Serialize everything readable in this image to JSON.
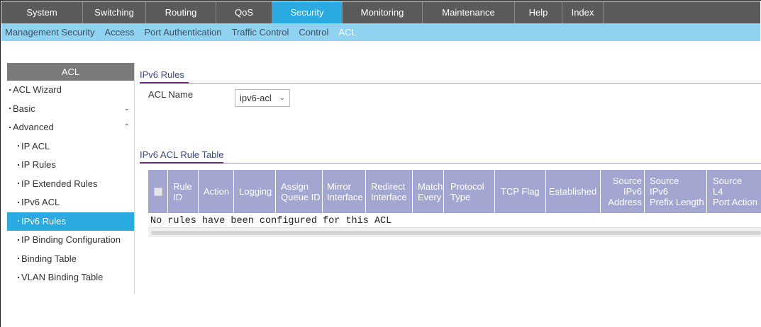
{
  "top_nav": {
    "tabs": [
      "System",
      "Switching",
      "Routing",
      "QoS",
      "Security",
      "Monitoring",
      "Maintenance",
      "Help",
      "Index"
    ],
    "active": "Security"
  },
  "sub_nav": {
    "items": [
      "Management Security",
      "Access",
      "Port Authentication",
      "Traffic Control",
      "Control",
      "ACL"
    ],
    "active": "ACL"
  },
  "sidebar": {
    "title": "ACL",
    "items": [
      {
        "label": "ACL Wizard"
      },
      {
        "label": "Basic"
      },
      {
        "label": "Advanced"
      },
      {
        "label": "IP ACL"
      },
      {
        "label": "IP Rules"
      },
      {
        "label": "IP Extended Rules"
      },
      {
        "label": "IPv6 ACL"
      },
      {
        "label": "IPv6 Rules"
      },
      {
        "label": "IP Binding Configuration"
      },
      {
        "label": "Binding Table"
      },
      {
        "label": "VLAN Binding Table"
      }
    ]
  },
  "ipv6_rules": {
    "section_title": "IPv6 Rules",
    "acl_name_label": "ACL Name",
    "acl_name_value": "ipv6-acl"
  },
  "rule_table": {
    "section_title": "IPv6 ACL Rule Table",
    "columns": [
      "Rule\nID",
      "Action",
      "Logging",
      "Assign\nQueue ID",
      "Mirror\nInterface",
      "Redirect\nInterface",
      "Match\nEvery",
      "Protocol\nType",
      "TCP Flag",
      "Established",
      "Source\nIPv6\nAddress",
      "Source\nIPv6\nPrefix Length",
      "Source\nL4\nPort Action"
    ],
    "empty_message": "No rules have been configured for this ACL"
  },
  "colors": {
    "nav_bg": "#5a5a5a",
    "accent": "#29abe2",
    "subnav_bg": "#8fd3f0",
    "table_header": "#a4a6d2",
    "section_title": "#3b4a86"
  }
}
